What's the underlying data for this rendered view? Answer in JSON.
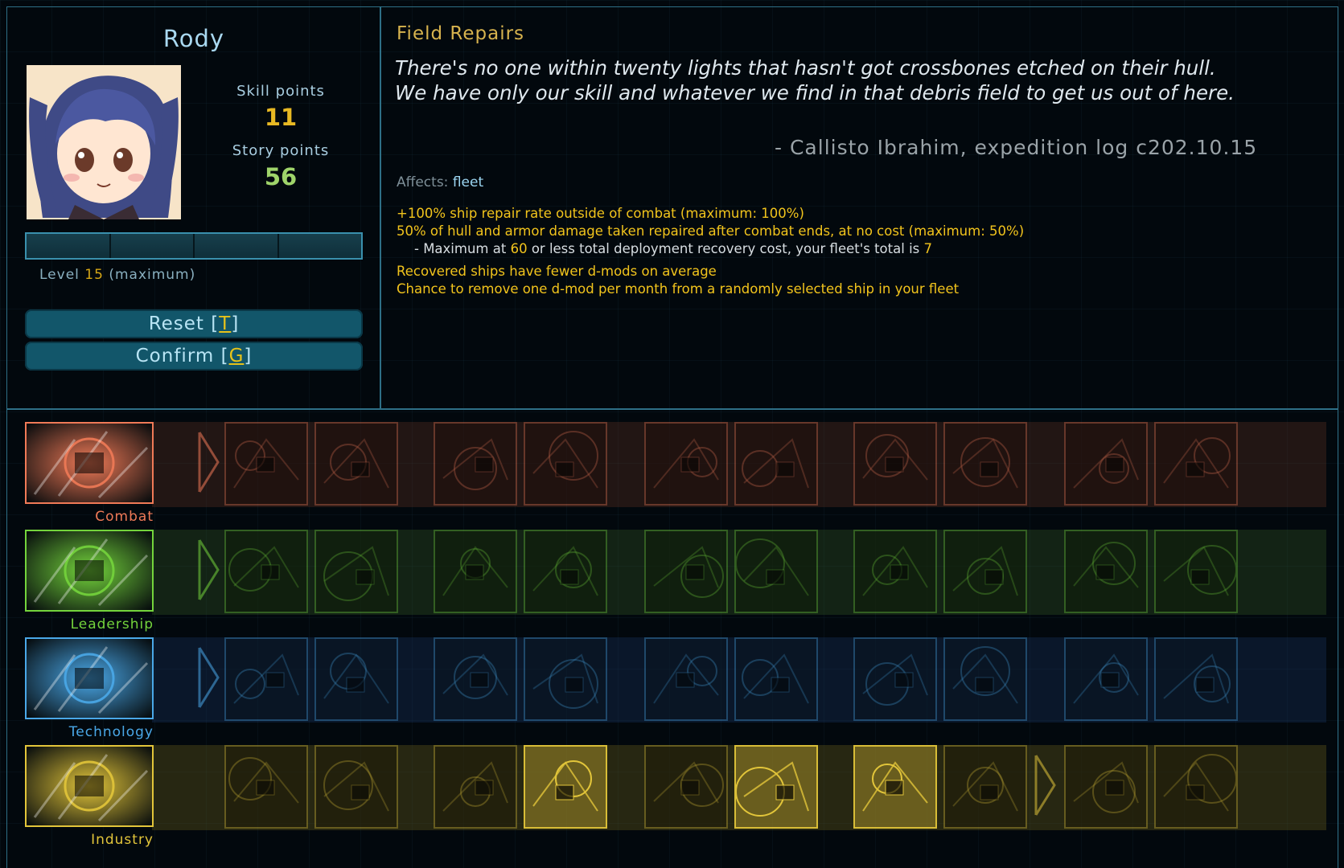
{
  "character": {
    "name": "Rody",
    "skill_points_label": "Skill points",
    "skill_points": "11",
    "story_points_label": "Story points",
    "story_points": "56",
    "level_prefix": "Level",
    "level": "15",
    "level_suffix": "(maximum)",
    "xp_fraction": 1.0
  },
  "buttons": {
    "reset_label": "Reset [",
    "reset_key": "T",
    "confirm_label": "Confirm [",
    "confirm_key": "G",
    "close": "]"
  },
  "skill": {
    "title": "Field Repairs",
    "quote_line1": "There's no one within twenty lights that hasn't got crossbones etched on their hull.",
    "quote_line2": "We have only our skill and whatever we find in that debris field to get us out of here.",
    "attribution": "- Callisto Ibrahim, expedition log c202.10.15",
    "affects_label": "Affects:",
    "affects_value": "fleet",
    "effect1": "+100% ship repair rate outside of combat (maximum: 100%)",
    "effect2": "50% of hull and armor damage taken repaired after combat ends, at no cost (maximum: 50%)",
    "effect3_pre": "- Maximum at ",
    "effect3_num": "60",
    "effect3_mid": " or less total deployment recovery cost, your fleet's total is ",
    "effect3_num2": "7",
    "effect4": "Recovered ships have fewer d-mods on average",
    "effect5": "Chance to remove one d-mod per month from a randomly selected ship in your fleet"
  },
  "aptitudes": [
    {
      "name": "Combat",
      "icon": "combat-icon",
      "color": "#f07a57"
    },
    {
      "name": "Leadership",
      "icon": "leadership-icon",
      "color": "#74d43c"
    },
    {
      "name": "Technology",
      "icon": "technology-icon",
      "color": "#4aa8e8"
    },
    {
      "name": "Industry",
      "icon": "industry-icon",
      "color": "#e2c53a"
    }
  ],
  "colors": {
    "accent": "#2e6f86",
    "highlight": "#f2c41c",
    "skill_points": "#e8b923",
    "story_points": "#9fd46a"
  }
}
